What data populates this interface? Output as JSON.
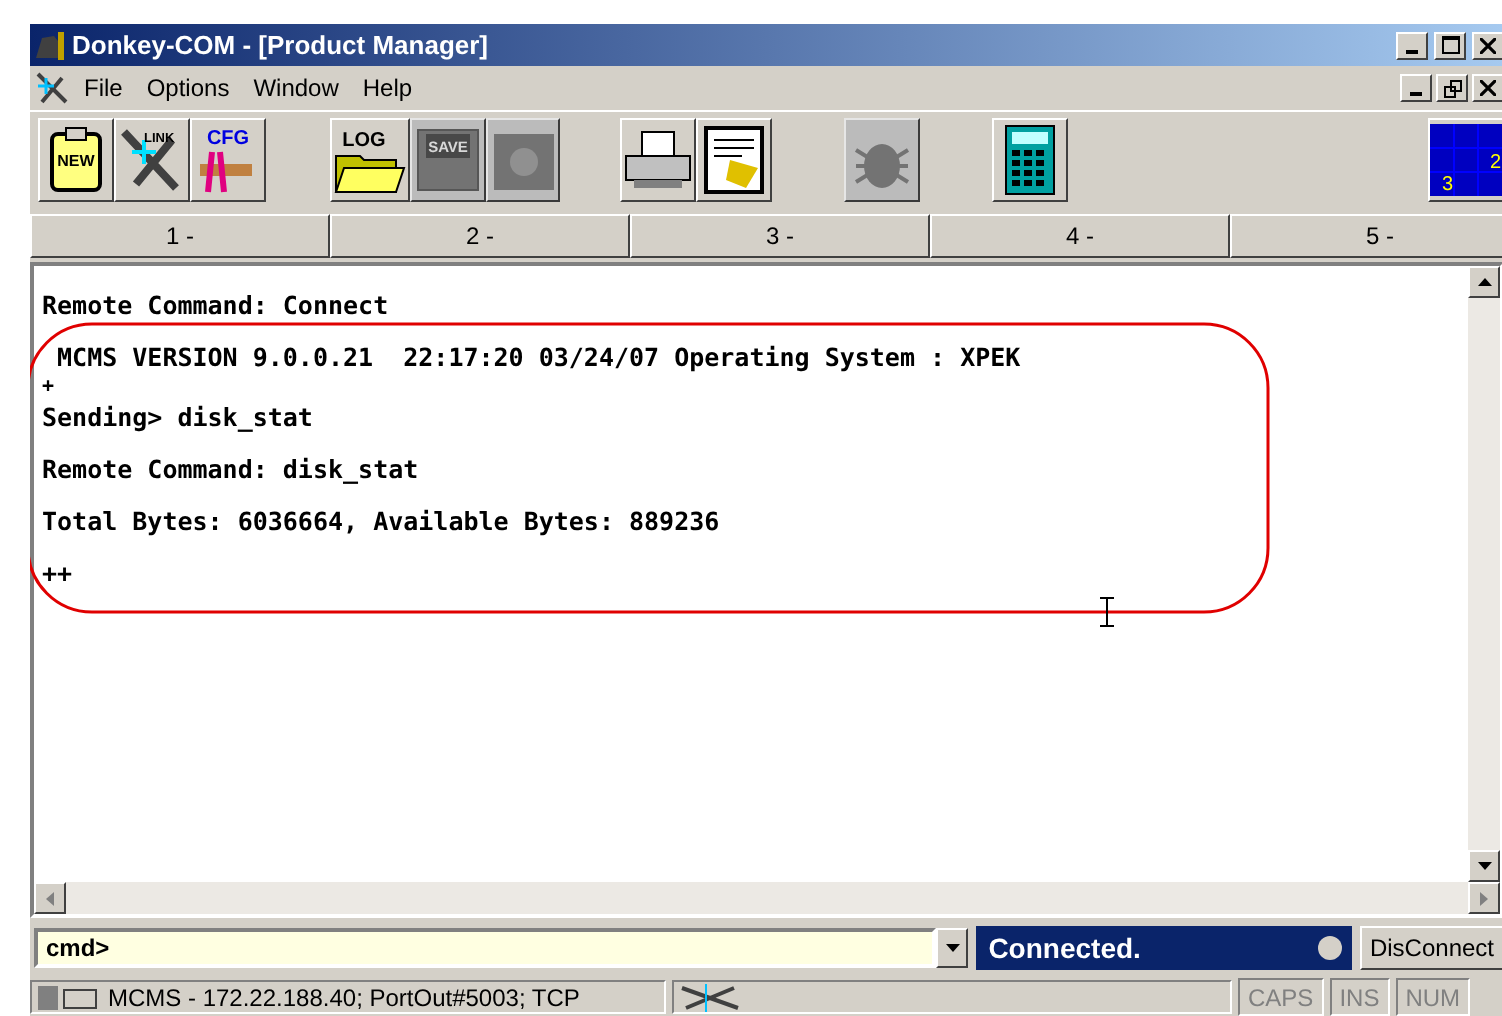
{
  "window": {
    "title": "Donkey-COM - [Product Manager]"
  },
  "menu": [
    {
      "label": "File"
    },
    {
      "label": "Options"
    },
    {
      "label": "Window"
    },
    {
      "label": "Help"
    }
  ],
  "toolbar": [
    {
      "kind": "new",
      "label": "NEW",
      "disabled": false
    },
    {
      "kind": "link",
      "label": "LINK",
      "disabled": false
    },
    {
      "kind": "cfg",
      "label": "CFG",
      "disabled": false
    },
    {
      "kind": "log",
      "label": "LOG",
      "disabled": false
    },
    {
      "kind": "save",
      "label": "SAVE",
      "disabled": true
    },
    {
      "kind": "camera",
      "disabled": true
    },
    {
      "kind": "print",
      "disabled": false
    },
    {
      "kind": "doc",
      "disabled": false
    },
    {
      "kind": "bug",
      "disabled": true
    },
    {
      "kind": "calc",
      "disabled": false
    },
    {
      "kind": "grid",
      "labels": [
        "2",
        "3"
      ],
      "disabled": false
    }
  ],
  "tabs": [
    {
      "label": "1 -",
      "selected": false
    },
    {
      "label": "2 -",
      "selected": false
    },
    {
      "label": "3 -",
      "selected": false
    },
    {
      "label": "4 -",
      "selected": false
    },
    {
      "label": "5 -",
      "selected": false
    }
  ],
  "terminal": [
    {
      "kind": "line",
      "text": "Remote Command: Connect"
    },
    {
      "kind": "line",
      "text": " MCMS VERSION 9.0.0.21  22:17:20 03/24/07 Operating System : XPEK"
    },
    {
      "kind": "marker",
      "text": "+"
    },
    {
      "kind": "line",
      "text": "Sending> disk_stat"
    },
    {
      "kind": "line",
      "text": "Remote Command: disk_stat"
    },
    {
      "kind": "line",
      "text": "Total Bytes: 6036664, Available Bytes: 889236"
    },
    {
      "kind": "line",
      "text": "++"
    }
  ],
  "command": {
    "value": "cmd>"
  },
  "connection": {
    "status": "Connected.",
    "button": "DisConnect"
  },
  "status_bar": {
    "text": "MCMS - 172.22.188.40; PortOut#5003; TCP",
    "indicators": [
      {
        "label": "CAPS",
        "on": false
      },
      {
        "label": "INS",
        "on": false
      },
      {
        "label": "NUM",
        "on": false
      }
    ]
  }
}
